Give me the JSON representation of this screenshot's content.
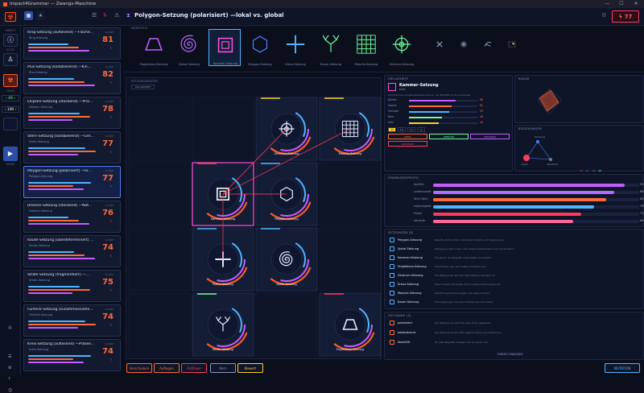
{
  "window": {
    "title": "Impact4Grammar — Zwangs-Maschine",
    "controls": [
      "—",
      "☐",
      "✕"
    ]
  },
  "topbar": {
    "score": "77",
    "score_icon": "bolt-icon"
  },
  "rail": {
    "labels": [
      "",
      "",
      "",
      "40",
      "100",
      "",
      ""
    ],
    "mode": "MODE"
  },
  "header": {
    "title": "Polygon-Setzung (polarisiert) —lokal vs. global",
    "icon": "hourglass-icon"
  },
  "toolbar_label": "WERKZEUG",
  "tools": [
    {
      "label": "Projektions-Setzung",
      "icon": "trapezoid-icon",
      "color": "#c75cff"
    },
    {
      "label": "Spiral-Setzung",
      "icon": "spiral-icon",
      "color": "#b06cff"
    },
    {
      "label": "Kammer-Setzung",
      "icon": "chamber-icon",
      "color": "#ff4fd8",
      "selected": true
    },
    {
      "label": "Polygon-Setzung",
      "icon": "hexagon-icon",
      "color": "#4f7cff"
    },
    {
      "label": "Kreuz-Setzung",
      "icon": "cross-icon",
      "color": "#4fb3ff"
    },
    {
      "label": "Baum-Setzung",
      "icon": "tree-icon",
      "color": "#6cff9c"
    },
    {
      "label": "Masche-Setzung",
      "icon": "mesh-icon",
      "color": "#6cff9c"
    },
    {
      "label": "Zentrum-Setzung",
      "icon": "crosshair-icon",
      "color": "#6cff9c"
    },
    {
      "label": "",
      "icon": "x-icon",
      "color": "#8a96bd"
    },
    {
      "label": "",
      "icon": "star-icon",
      "color": "#8a96bd"
    },
    {
      "label": "",
      "icon": "squiggle-icon",
      "color": "#8a96bd"
    },
    {
      "label": "",
      "icon": "dots-icon",
      "color": "#ffcc33"
    }
  ],
  "list": [
    {
      "name": "Ring-Setzung [auflösend] —Fläche...",
      "sub": "Ring-Setzung",
      "score": "81"
    },
    {
      "name": "Plus-Setzung [kollabierend] —Kin...",
      "sub": "Plus-Setzung",
      "score": "82"
    },
    {
      "name": "Ellipsen-Setzung [stockend] —Prio...",
      "sub": "Ellipsen-Setzung",
      "score": "78"
    },
    {
      "name": "Stern-Setzung [kollabierend] —Gre...",
      "sub": "Stern-Setzung",
      "score": "77"
    },
    {
      "name": "Polygon-Setzung [polarisiert] —lo...",
      "sub": "Polygon-Setzung",
      "score": "77",
      "selected": true
    },
    {
      "name": "Dreieck-Setzung [stockend] —Not...",
      "sub": "Dreieck-Setzung",
      "score": "76"
    },
    {
      "name": "Raute-Setzung [überdeterminiert] ...",
      "sub": "Raute-Setzung",
      "score": "74"
    },
    {
      "name": "Strahl-Setzung [fragmentiert] —...",
      "sub": "Strahl-Setzung",
      "score": "75"
    },
    {
      "name": "Fünfeck-Setzung [zusammenziehe...",
      "sub": "Fünfeck-Setzung",
      "score": "74"
    },
    {
      "name": "Kreis-Setzung [auflösend] —Präsen...",
      "sub": "Kreis-Setzung",
      "score": "74"
    }
  ],
  "grid": {
    "title": "SETZUNGSRASTER",
    "chip": "POLARISIERT",
    "cells": [
      {
        "label": "Zentrum-Setzung",
        "icon": "crosshair-icon"
      },
      {
        "label": "Masche-Setzung",
        "icon": "mesh-icon"
      },
      {
        "label": "Kammer-Setzung",
        "icon": "chamber-icon"
      },
      {
        "label": "Polygon-Setzung",
        "icon": "hexagon-icon"
      },
      {
        "label": "Kreuz-Setzung",
        "icon": "cross-icon"
      },
      {
        "label": "Spiral-Setzung",
        "icon": "spiral-icon"
      },
      {
        "label": "Baum-Setzung",
        "icon": "tree-icon"
      },
      {
        "label": "Projektions-Setzung",
        "icon": "trapezoid-icon"
      }
    ]
  },
  "bottom": [
    {
      "label": "Verschieben",
      "color": "#ff6a3a"
    },
    {
      "label": "Auflegen",
      "color": "#ff6a3a"
    },
    {
      "label": "Auflösen",
      "color": "#ff3a5a"
    },
    {
      "label": "Kern",
      "color": "#8a96bd"
    },
    {
      "label": "Bewert",
      "color": "#ffcc33"
    },
    {
      "label": "MUTATION",
      "color": "#4fb3ff"
    }
  ],
  "detail": {
    "title": "ZIELLEGRIFF",
    "name": "Kammer-Setzung",
    "sub": "Kreis",
    "desc": "Eine Kammer eingeschlossener Raum, der Begriffe dicht einschließt.",
    "stats": [
      {
        "k": "Dichte",
        "v": "68",
        "color": "#c75cff"
      },
      {
        "k": "Impuls",
        "v": "62",
        "color": "#ff6a3a"
      },
      {
        "k": "Grenzen",
        "v": "59",
        "color": "#4fb3ff"
      },
      {
        "k": "Kern",
        "v": "48",
        "color": "#6cff9c"
      },
      {
        "k": "Feld",
        "v": "43",
        "color": "#ffcc33"
      }
    ],
    "tabs": [
      "1d",
      "1w",
      "1m",
      "1y"
    ],
    "tags": [
      {
        "t": "DIREL",
        "c": "#ff6a3a"
      },
      {
        "t": "GEBUND",
        "c": "#6cff9c"
      },
      {
        "t": "ABGRENZ",
        "c": "#c75cff"
      },
      {
        "t": "GESTÄRKT",
        "c": "#ff3a5a"
      }
    ]
  },
  "radar": {
    "title": "RADAR"
  },
  "graph": {
    "title": "BEZIEHUNGEN",
    "n": [
      "Kreis",
      "Ordnung",
      "Zentrum"
    ],
    "legend": [
      "78",
      "67",
      "22",
      "90"
    ]
  },
  "bars": {
    "title": "SPANNUNGSPROFIL",
    "items": [
      {
        "k": "Konflikt",
        "v": "93",
        "color": "#c75cff"
      },
      {
        "k": "Leidenschaft",
        "v": "88",
        "color": "#b06cff"
      },
      {
        "k": "Nicht Nein",
        "v": "84",
        "color": "#ff6a3a"
      },
      {
        "k": "Lebendigkeit",
        "v": "78",
        "color": "#4fb3ff"
      },
      {
        "k": "Fehler",
        "v": "72",
        "color": "#ff3a5a"
      },
      {
        "k": "Variante",
        "v": "68",
        "color": "#ff6a9c"
      }
    ]
  },
  "defs": {
    "title": "SETZUNGEN (8)",
    "items": [
      {
        "k": "Polygon-Setzung",
        "d": "Begriffe bilden Ecken mit klaren Kanten und Abgrenzung."
      },
      {
        "k": "Spiral-Setzung",
        "d": "Bewegung nach innen, sich selbst wiederholend und verdichtend."
      },
      {
        "k": "Kammer-Setzung",
        "d": "Ein Raum, der Begriffe umschließt und schützt."
      },
      {
        "k": "Projektions-Setzung",
        "d": "Eine Fläche, die nach außen projiziert wird."
      },
      {
        "k": "Zentrum-Setzung",
        "d": "Ein Mittelpunkt, auf den alles Weitere bezogen ist."
      },
      {
        "k": "Kreuz-Setzung",
        "d": "Zwei Achsen schneiden sich in einem Kreuzungspunkt."
      },
      {
        "k": "Masche-Setzung",
        "d": "Netzförmige Verbindungen mit vielen Knoten."
      },
      {
        "k": "Baum-Setzung",
        "d": "Verzweigungen von einer Wurzel aus nach oben."
      }
    ]
  },
  "states": {
    "title": "ZUSTÄNDE (3)",
    "items": [
      {
        "k": "polarisiert",
        "d": "Die Setzung ist zwischen zwei Polen gespannt."
      },
      {
        "k": "kollabierend",
        "d": "Die Setzung bricht unter eigener Spannung zusammen."
      },
      {
        "k": "überfüllt",
        "d": "Zu viele Begriffe drängen sich an einem Ort."
      }
    ],
    "more": "MINDER EINBINDEN"
  }
}
